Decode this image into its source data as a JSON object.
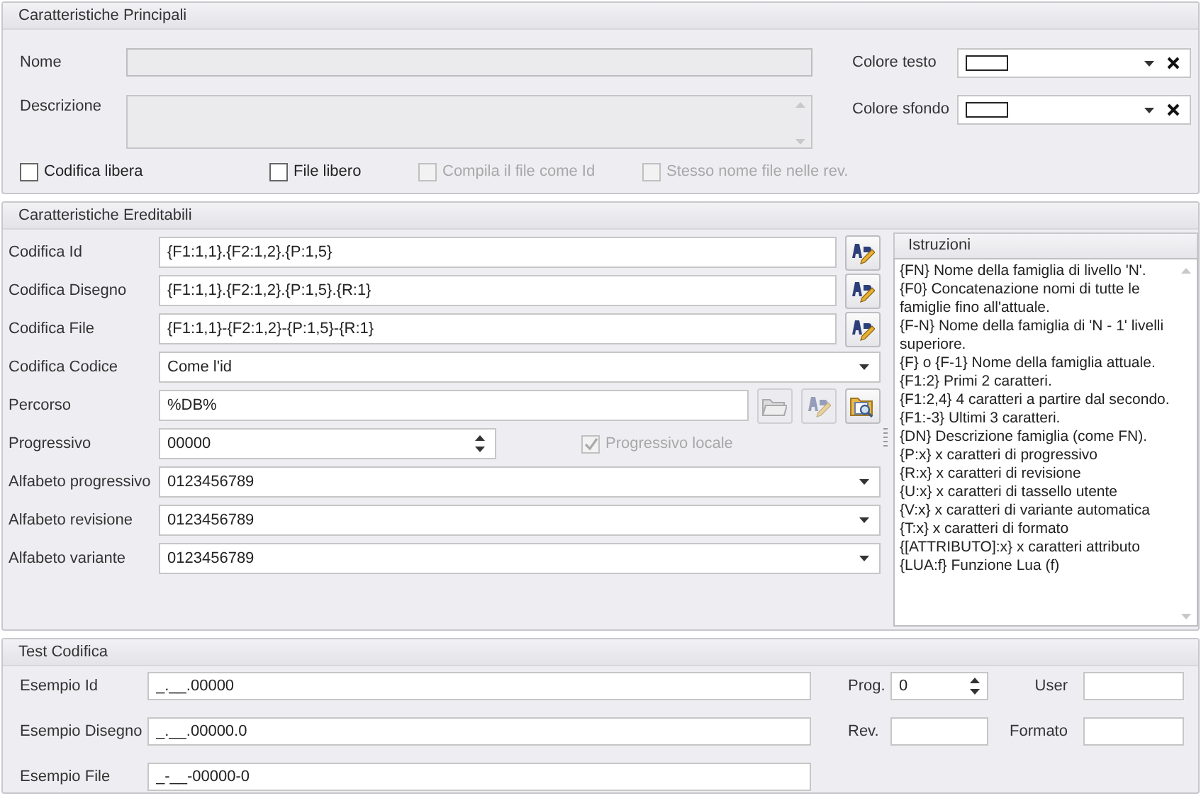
{
  "principali": {
    "title": "Caratteristiche Principali",
    "nome": {
      "label": "Nome",
      "disabled": true
    },
    "descrizione": {
      "label": "Descrizione",
      "disabled": true
    },
    "colors": [
      {
        "label": "Colore testo"
      },
      {
        "label": "Colore sfondo"
      }
    ],
    "checkboxes": [
      {
        "label": "Codifica libera",
        "checked": false,
        "disabled": false
      },
      {
        "label": "File libero",
        "checked": false,
        "disabled": false
      },
      {
        "label": "Compila il file come Id",
        "checked": false,
        "disabled": true
      },
      {
        "label": "Stesso nome file nelle rev.",
        "checked": false,
        "disabled": true
      }
    ]
  },
  "ereditabili": {
    "title": "Caratteristiche Ereditabili",
    "rows": [
      {
        "kind": "text",
        "label": "Codifica Id",
        "value": "{F1:1,1}.{F2:1,2}.{P:1,5}"
      },
      {
        "kind": "text",
        "label": "Codifica Disegno",
        "value": "{F1:1,1}.{F2:1,2}.{P:1,5}.{R:1}"
      },
      {
        "kind": "text",
        "label": "Codifica File",
        "value": "{F1:1,1}-{F2:1,2}-{P:1,5}-{R:1}"
      },
      {
        "kind": "combo",
        "label": "Codifica Codice",
        "value": "Come l'id"
      },
      {
        "kind": "path",
        "label": "Percorso",
        "value": "%DB%"
      },
      {
        "kind": "spin",
        "label": "Progressivo",
        "value": "00000",
        "checkbox": {
          "label": "Progressivo locale",
          "checked": true,
          "disabled": true
        }
      },
      {
        "kind": "combo",
        "label": "Alfabeto progressivo",
        "value": "0123456789"
      },
      {
        "kind": "combo",
        "label": "Alfabeto revisione",
        "value": "0123456789"
      },
      {
        "kind": "combo",
        "label": "Alfabeto variante",
        "value": "0123456789"
      }
    ],
    "istruzioni": {
      "title": "Istruzioni",
      "lines": [
        "{FN} Nome della famiglia di livello 'N'.",
        "{F0} Concatenazione nomi di tutte le famiglie fino all'attuale.",
        "{F-N} Nome della famiglia di 'N - 1' livelli superiore.",
        "{F} o {F-1} Nome della famiglia attuale.",
        "{F1:2} Primi 2 caratteri.",
        "{F1:2,4} 4 caratteri a partire dal secondo.",
        "{F1:-3} Ultimi 3 caratteri.",
        "{DN} Descrizione famiglia (come FN).",
        "{P:x} x caratteri di progressivo",
        "{R:x} x caratteri di revisione",
        "{U:x} x caratteri di tassello utente",
        "{V:x} x caratteri di variante automatica",
        "{T:x} x caratteri di formato",
        "{[ATTRIBUTO]:x} x caratteri attributo",
        "{LUA:f} Funzione Lua (f)"
      ]
    }
  },
  "test": {
    "title": "Test Codifica",
    "fields": [
      {
        "label": "Esempio Id",
        "value": "_.__.00000"
      },
      {
        "label": "Esempio Disegno",
        "value": "_.__.00000.0"
      },
      {
        "label": "Esempio File",
        "value": "_-__-00000-0"
      }
    ],
    "prog": {
      "label": "Prog.",
      "value": "0"
    },
    "user": {
      "label": "User"
    },
    "rev": {
      "label": "Rev."
    },
    "formato": {
      "label": "Formato"
    }
  }
}
